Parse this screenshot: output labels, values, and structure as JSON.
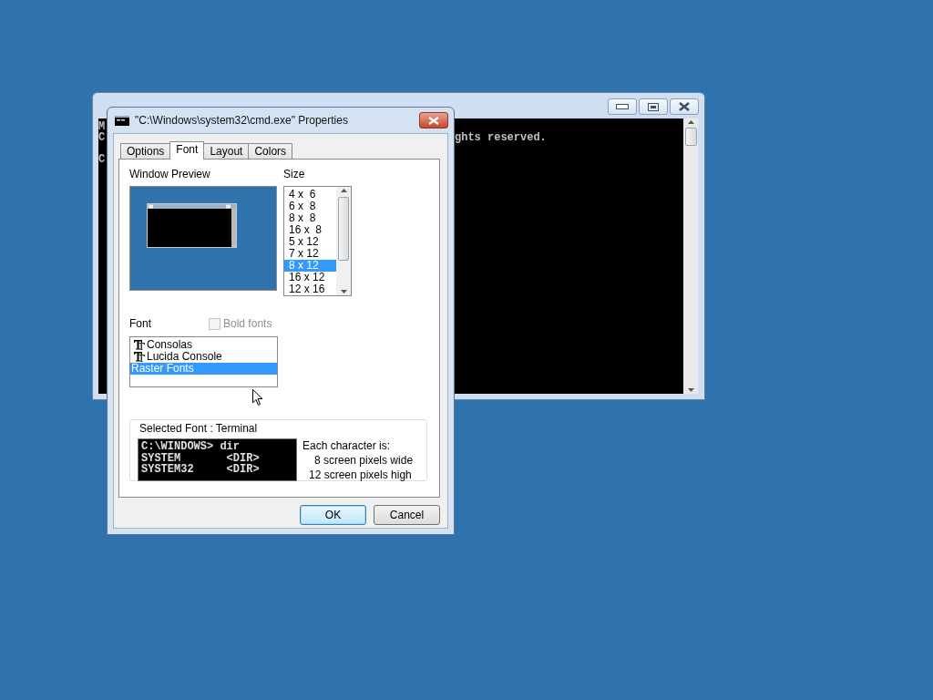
{
  "console_window": {
    "left_column_blocks": [
      [
        "M",
        "C"
      ],
      [
        "C"
      ]
    ],
    "text": "ghts reserved."
  },
  "dialog": {
    "title": "\"C:\\Windows\\system32\\cmd.exe\" Properties",
    "tabs": [
      {
        "label": "Options",
        "selected": false
      },
      {
        "label": "Font",
        "selected": true
      },
      {
        "label": "Layout",
        "selected": false
      },
      {
        "label": "Colors",
        "selected": false
      }
    ],
    "window_preview_label": "Window Preview",
    "size_label": "Size",
    "sizes": [
      {
        "label": "4 x  6",
        "selected": false
      },
      {
        "label": "6 x  8",
        "selected": false
      },
      {
        "label": "8 x  8",
        "selected": false
      },
      {
        "label": "16 x  8",
        "selected": false
      },
      {
        "label": "5 x 12",
        "selected": false
      },
      {
        "label": "7 x 12",
        "selected": false
      },
      {
        "label": "8 x 12",
        "selected": true
      },
      {
        "label": "16 x 12",
        "selected": false
      },
      {
        "label": "12 x 16",
        "selected": false
      }
    ],
    "font_label": "Font",
    "bold_fonts": {
      "label": "Bold fonts",
      "checked": false,
      "disabled": true
    },
    "fonts": [
      {
        "name": "Consolas",
        "kind": "truetype",
        "selected": false
      },
      {
        "name": "Lucida Console",
        "kind": "truetype",
        "selected": false
      },
      {
        "name": "Raster Fonts",
        "kind": "raster",
        "selected": true
      }
    ],
    "selected_font": {
      "caption": "Selected Font : Terminal",
      "preview_lines": [
        "C:\\WINDOWS> dir",
        "SYSTEM       <DIR>",
        "SYSTEM32     <DIR>"
      ],
      "info": [
        "Each character is:",
        "8 screen pixels wide",
        "12 screen pixels high"
      ]
    },
    "buttons": [
      {
        "label": "OK",
        "default": true
      },
      {
        "label": "Cancel",
        "default": false
      }
    ]
  }
}
